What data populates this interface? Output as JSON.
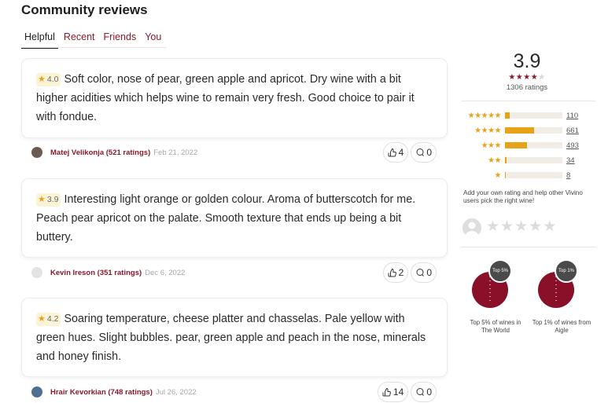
{
  "section_title": "Community reviews",
  "tabs": [
    {
      "label": "Helpful",
      "active": true
    },
    {
      "label": "Recent",
      "active": false
    },
    {
      "label": "Friends",
      "active": false
    },
    {
      "label": "You",
      "active": false
    }
  ],
  "reviews": [
    {
      "rating": "4.0",
      "text": "Soft color, nose of pear, green apple and apricot. Dry wine with a bit higher acidities which helps wine to remain very fresh. Good choice to pair it with fondue.",
      "author": "Matej Velikonja (521 ratings)",
      "date": "Feb 21, 2022",
      "likes": "4",
      "comments": "0"
    },
    {
      "rating": "3.9",
      "text": "Interesting light orange or golden colour. Aroma of butterscotch for me. Peach pear apricot on the palate. Smooth texture that ends up being a bit buttery.",
      "author": "Kevin Ireson (351 ratings)",
      "date": "Dec 6, 2022",
      "likes": "2",
      "comments": "0"
    },
    {
      "rating": "4.2",
      "text": "Soaring temperature, cheese platter and chasselas. Pale yellow with green hues. Slight bubbles. pear, green apple and peach in the nose, minerals and honey finish.",
      "author": "Hrair Kevorkian (748 ratings)",
      "date": "Jul 26, 2022",
      "likes": "14",
      "comments": "0"
    }
  ],
  "summary": {
    "average": "3.9",
    "stars_filled": 4,
    "ratings_count": "1306 ratings",
    "distribution": [
      {
        "stars": 5,
        "count": "110",
        "fraction": 0.08
      },
      {
        "stars": 4,
        "count": "661",
        "fraction": 0.51
      },
      {
        "stars": 3,
        "count": "493",
        "fraction": 0.38
      },
      {
        "stars": 2,
        "count": "34",
        "fraction": 0.03
      },
      {
        "stars": 1,
        "count": "8",
        "fraction": 0.01
      }
    ],
    "add_rating_text": "Add your own rating and help other Vivino users pick the right wine!"
  },
  "awards": [
    {
      "badge": "Top 5%",
      "label": "Top 5% of wines in The World"
    },
    {
      "badge": "Top 1%",
      "label": "Top 1% of wines from Aigle"
    }
  ],
  "colors": {
    "accent": "#8a1a2b",
    "star": "#e6a317",
    "bottle": "#8a0f28"
  }
}
